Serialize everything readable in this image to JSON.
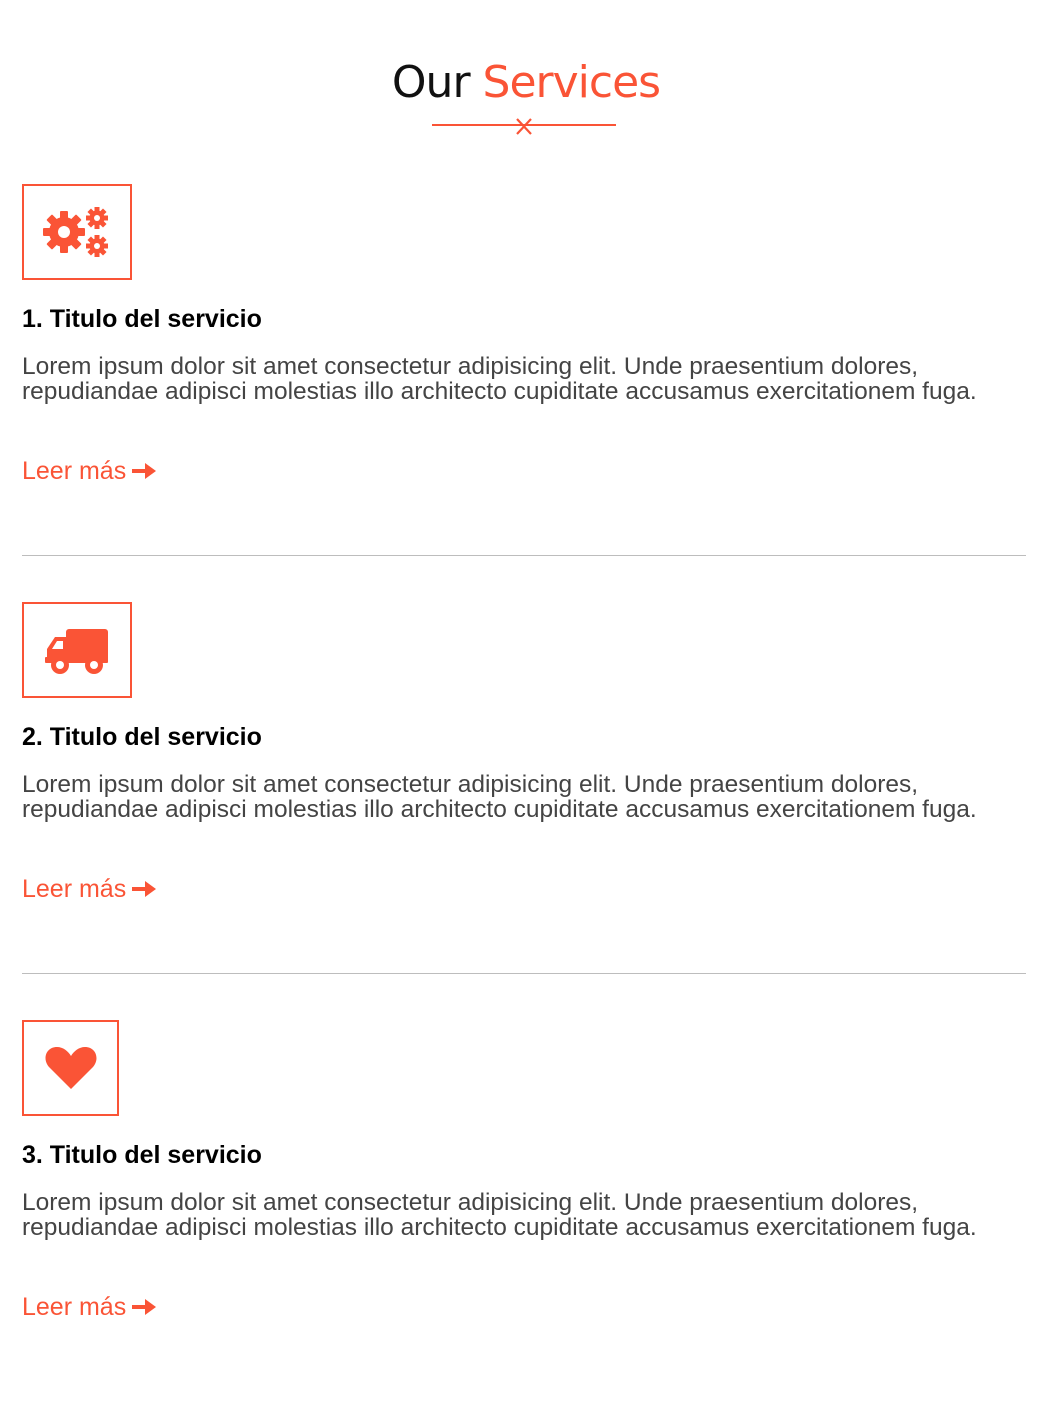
{
  "section": {
    "title_part1": "Our",
    "title_part2": "Services"
  },
  "services": [
    {
      "icon": "cogs-icon",
      "title": "1. Titulo del servicio",
      "text": "Lorem ipsum dolor sit amet consectetur adipisicing elit. Unde praesentium dolores, repudiandae adipisci molestias illo architecto cupiditate accusamus exercitationem fuga.",
      "link_label": "Leer más"
    },
    {
      "icon": "truck-icon",
      "title": "2. Titulo del servicio",
      "text": "Lorem ipsum dolor sit amet consectetur adipisicing elit. Unde praesentium dolores, repudiandae adipisci molestias illo architecto cupiditate accusamus exercitationem fuga.",
      "link_label": "Leer más"
    },
    {
      "icon": "heart-icon",
      "title": "3. Titulo del servicio",
      "text": "Lorem ipsum dolor sit amet consectetur adipisicing elit. Unde praesentium dolores, repudiandae adipisci molestias illo architecto cupiditate accusamus exercitationem fuga.",
      "link_label": "Leer más"
    }
  ],
  "colors": {
    "accent": "#fa5436",
    "heading": "#111111",
    "body_text": "#444444",
    "separator": "#bdbdbd"
  }
}
